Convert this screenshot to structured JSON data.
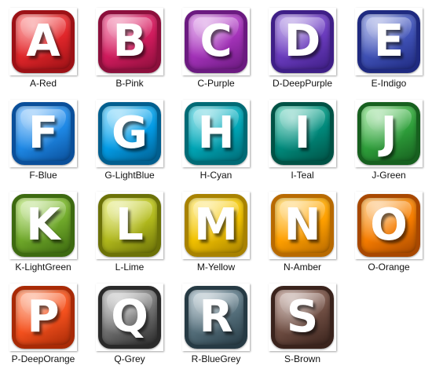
{
  "icons": [
    {
      "letter": "A",
      "label": "A-Red",
      "colors": {
        "light": "#ff6b6b",
        "mid": "#e0262a",
        "dark": "#9c1116"
      }
    },
    {
      "letter": "B",
      "label": "B-Pink",
      "colors": {
        "light": "#f25a92",
        "mid": "#d01b5d",
        "dark": "#8c0f3c"
      }
    },
    {
      "letter": "C",
      "label": "C-Purple",
      "colors": {
        "light": "#d77fe6",
        "mid": "#a332b8",
        "dark": "#6b1a80"
      }
    },
    {
      "letter": "D",
      "label": "D-DeepPurple",
      "colors": {
        "light": "#9a73e0",
        "mid": "#6a3bbd",
        "dark": "#3f1f87"
      }
    },
    {
      "letter": "E",
      "label": "E-Indigo",
      "colors": {
        "light": "#7f8fe0",
        "mid": "#3f51b5",
        "dark": "#1f2a80"
      }
    },
    {
      "letter": "F",
      "label": "F-Blue",
      "colors": {
        "light": "#62b3ff",
        "mid": "#1e88e5",
        "dark": "#0a4f9a"
      }
    },
    {
      "letter": "G",
      "label": "G-LightBlue",
      "colors": {
        "light": "#5fd0ff",
        "mid": "#039be5",
        "dark": "#025f8f"
      }
    },
    {
      "letter": "H",
      "label": "H-Cyan",
      "colors": {
        "light": "#4fd2e0",
        "mid": "#00a5b5",
        "dark": "#006a75"
      }
    },
    {
      "letter": "I",
      "label": "I-Teal",
      "colors": {
        "light": "#4fd0b5",
        "mid": "#00897b",
        "dark": "#005245"
      }
    },
    {
      "letter": "J",
      "label": "J-Green",
      "colors": {
        "light": "#7fe07f",
        "mid": "#2e9e3a",
        "dark": "#17601f"
      }
    },
    {
      "letter": "K",
      "label": "K-LightGreen",
      "colors": {
        "light": "#b5e66b",
        "mid": "#6fa82a",
        "dark": "#3d6a10"
      }
    },
    {
      "letter": "L",
      "label": "L-Lime",
      "colors": {
        "light": "#e4ec5a",
        "mid": "#b0b81c",
        "dark": "#6c7208"
      }
    },
    {
      "letter": "M",
      "label": "M-Yellow",
      "colors": {
        "light": "#ffe55a",
        "mid": "#f2c200",
        "dark": "#a88200"
      }
    },
    {
      "letter": "N",
      "label": "N-Amber",
      "colors": {
        "light": "#ffcf4a",
        "mid": "#ffa000",
        "dark": "#b86a00"
      }
    },
    {
      "letter": "O",
      "label": "O-Orange",
      "colors": {
        "light": "#ffb24a",
        "mid": "#f57c00",
        "dark": "#a84800"
      }
    },
    {
      "letter": "P",
      "label": "P-DeepOrange",
      "colors": {
        "light": "#ff8a5a",
        "mid": "#f4511e",
        "dark": "#a82a06"
      }
    },
    {
      "letter": "Q",
      "label": "Q-Grey",
      "colors": {
        "light": "#bdbdbd",
        "mid": "#6e6e6e",
        "dark": "#2a2a2a"
      }
    },
    {
      "letter": "R",
      "label": "R-BlueGrey",
      "colors": {
        "light": "#9fb6c2",
        "mid": "#546e7a",
        "dark": "#263a44"
      }
    },
    {
      "letter": "S",
      "label": "S-Brown",
      "colors": {
        "light": "#b08a7e",
        "mid": "#6d4c41",
        "dark": "#3a231c"
      }
    }
  ]
}
